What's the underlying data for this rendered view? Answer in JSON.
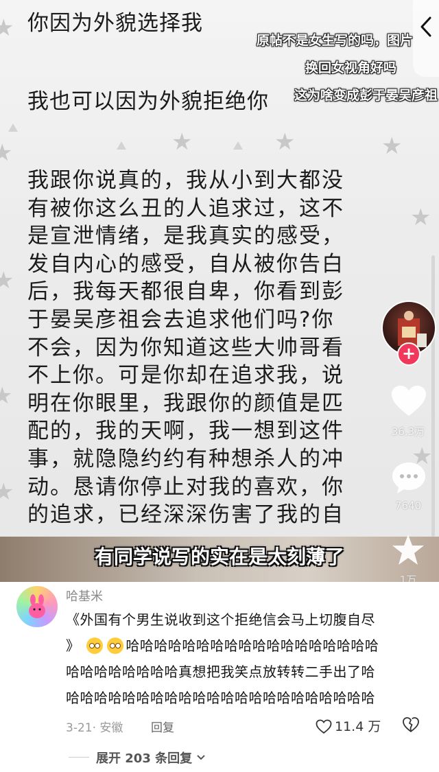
{
  "video": {
    "doc_line1": "你因为外貌选择我",
    "doc_line2": "我也可以因为外貌拒绝你",
    "doc_paragraph": [
      "我跟你说真的，我从小到大都没",
      "有被你这么丑的人追求过，这不",
      "是宣泄情绪，是我真实的感受，",
      "发自内心的感受，自从被你告白",
      "后，我每天都很自卑，你看到彭",
      "于晏吴彦祖会去追求他们吗?你",
      "不会，因为你知道这些大帅哥看",
      "不上你。可是你却在追求我，说",
      "明在你眼里，我跟你的颜值是匹",
      "配的，我的天啊，我一想到这件",
      "事，就隐隐约约有种想杀人的冲",
      "动。恳请你停止对我的喜欢，你",
      "的追求，已经深深伤害了我的自"
    ],
    "overlay_captions": [
      "原帖不是女生写的吗，图片",
      "换回女视角好吗",
      "这为啥变成彭于晏吴彦祖"
    ],
    "subtitle": "有同学说写的实在是太刻薄了",
    "like_count": "36.3万",
    "comment_count": "7640",
    "share_count": "1万",
    "accent_color": "#f2385a"
  },
  "comment": {
    "username": "哈基米",
    "body_lines": [
      "《外国有个男生说收到这个拒绝信会马上切腹自尽",
      "》",
      "哈哈哈哈哈哈哈哈哈哈哈哈哈哈哈哈哈哈",
      "哈哈哈哈哈哈哈哈真想把我笑点放转转二手出了哈",
      "哈哈哈哈哈哈哈哈哈哈哈哈哈哈哈哈哈哈哈哈哈哈"
    ],
    "emoji_names": [
      "drooling-face-icon",
      "drooling-face-icon"
    ],
    "meta": "3-21· 安徽",
    "reply_label": "回复",
    "like_count": "11.4 万",
    "expand_label": "展开 203 条回复"
  }
}
